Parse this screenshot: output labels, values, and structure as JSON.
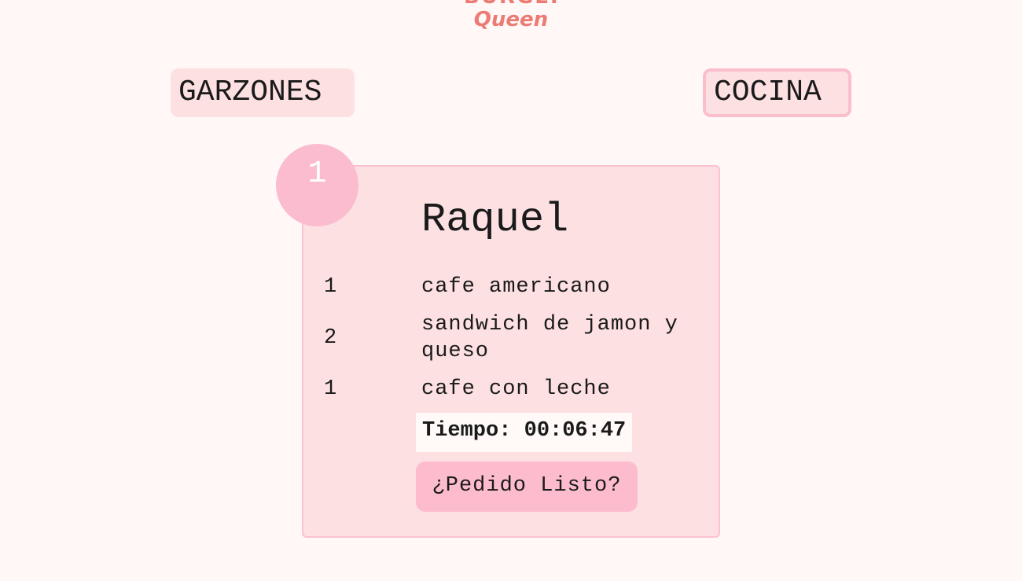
{
  "logo": {
    "top_text": "BURGER",
    "bottom_text": "Queen"
  },
  "nav": {
    "waiters_label": "GARZONES",
    "kitchen_label": "COCINA"
  },
  "order": {
    "number": "1",
    "client_name": "Raquel",
    "items": [
      {
        "qty": "1",
        "name": "cafe americano"
      },
      {
        "qty": "2",
        "name": "sandwich de jamon y queso"
      },
      {
        "qty": "1",
        "name": "cafe con leche"
      }
    ],
    "timer": "Tiempo: 00:06:47",
    "ready_button_label": "¿Pedido Listo?"
  },
  "colors": {
    "background": "#fff8f7",
    "card": "#fde0e2",
    "accent_pink": "#fbbecd",
    "logo": "#ec7b74"
  }
}
